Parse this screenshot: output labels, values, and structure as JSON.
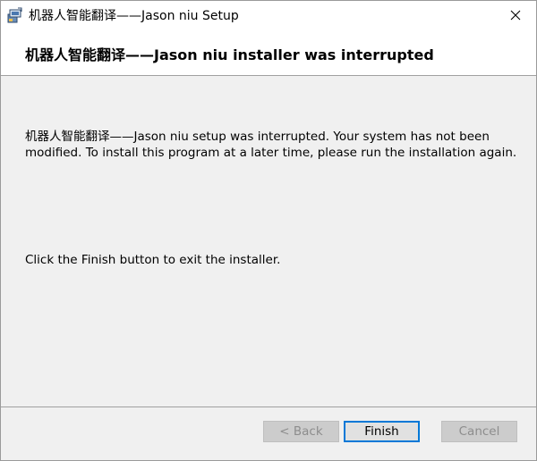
{
  "window": {
    "title": "机器人智能翻译——Jason niu Setup",
    "app_icon": "installer-box-icon",
    "close_icon": "close-icon"
  },
  "header": {
    "heading": "机器人智能翻译——Jason niu installer was interrupted"
  },
  "content": {
    "message": "机器人智能翻译——Jason niu setup was interrupted. Your system has not been modified. To install this program at a later time, please run the installation again.",
    "instruction": "Click the Finish button to exit the installer."
  },
  "footer": {
    "back_label": "< Back",
    "finish_label": "Finish",
    "cancel_label": "Cancel"
  },
  "colors": {
    "focus_border": "#0078d7",
    "window_bg": "#f0f0f0"
  }
}
